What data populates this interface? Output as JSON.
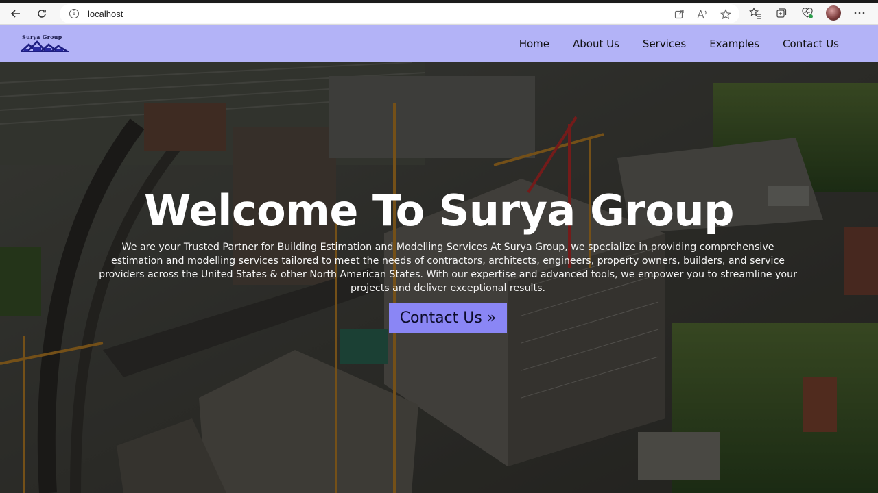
{
  "browser": {
    "url": "localhost",
    "info_icon": "info-icon",
    "icons": [
      "back-arrow-icon",
      "reload-icon",
      "open-in-app-icon",
      "read-aloud-icon",
      "favorite-star-icon",
      "favorites-icon",
      "collections-icon",
      "health-icon",
      "profile-avatar",
      "more-menu-icon"
    ],
    "read_aloud_label": "Aᵃ"
  },
  "header": {
    "logo_text": "Surya Group",
    "nav": [
      {
        "label": "Home"
      },
      {
        "label": "About Us"
      },
      {
        "label": "Services"
      },
      {
        "label": "Examples"
      },
      {
        "label": "Contact Us"
      }
    ],
    "background_color": "#b3b3f7"
  },
  "hero": {
    "title": "Welcome To Surya Group",
    "description": "We are your Trusted Partner for Building Estimation and Modelling Services At Surya Group, we specialize in providing comprehensive estimation and modelling services tailored to meet the needs of contractors, architects, engineers, property owners, builders, and service providers across the United States & other North American States. With our expertise and advanced tools, we empower you to streamline your projects and deliver exceptional results.",
    "cta_label": "Contact Us »",
    "cta_color": "#8a86f5",
    "background_image": "construction-site-aerial-photo"
  }
}
